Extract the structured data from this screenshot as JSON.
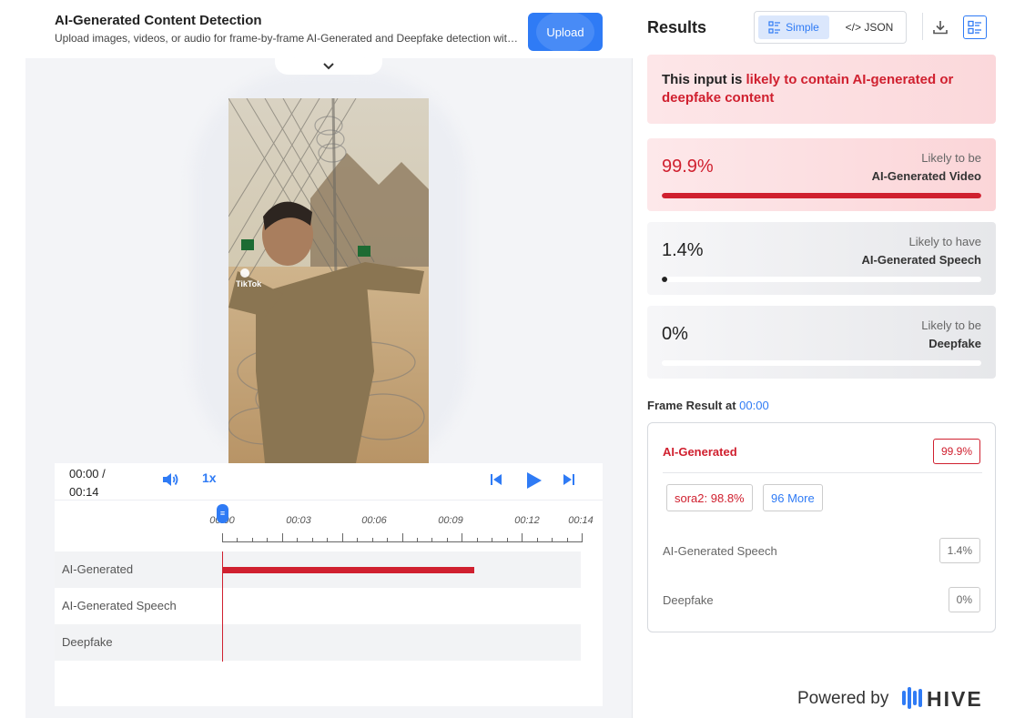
{
  "header": {
    "title": "AI-Generated Content Detection",
    "subtitle": "Upload images, videos, or audio for frame-by-frame AI-Generated and Deepfake detection with...",
    "upload_label": "Upload"
  },
  "video": {
    "watermark": "TikTok"
  },
  "player": {
    "current_time": "00:00 /",
    "duration": "00:14",
    "speed": "1x",
    "ticks": [
      "00:00",
      "00:03",
      "00:06",
      "00:09",
      "00:12",
      "00:14"
    ],
    "tracks": [
      {
        "label": "AI-Generated",
        "active_fraction": 0.7
      },
      {
        "label": "AI-Generated Speech",
        "active_fraction": 0
      },
      {
        "label": "Deepfake",
        "active_fraction": 0
      }
    ]
  },
  "results": {
    "title": "Results",
    "simple_label": "Simple",
    "json_label": "</> JSON",
    "verdict_prefix": "This input is ",
    "verdict_highlight": "likely to contain AI-generated or deepfake content",
    "cards": [
      {
        "pct": "99.9%",
        "value": 0.999,
        "line1": "Likely to be",
        "line2": "AI-Generated Video",
        "tone": "red"
      },
      {
        "pct": "1.4%",
        "value": 0.014,
        "line1": "Likely to have",
        "line2": "AI-Generated Speech",
        "tone": "gray"
      },
      {
        "pct": "0%",
        "value": 0,
        "line1": "Likely to be",
        "line2": "Deepfake",
        "tone": "gray"
      }
    ],
    "frame_result_label": "Frame Result at ",
    "frame_result_time": "00:00",
    "frame": {
      "ai_generated_label": "AI-Generated",
      "ai_generated_score": "99.9%",
      "chip_model": "sora2: 98.8%",
      "chip_more": "96 More",
      "speech_label": "AI-Generated Speech",
      "speech_score": "1.4%",
      "deepfake_label": "Deepfake",
      "deepfake_score": "0%"
    }
  },
  "footer": {
    "powered_by": "Powered by",
    "brand": "HIVE"
  },
  "colors": {
    "accent": "#2f7bf5",
    "alert": "#d0202f"
  },
  "icons": [
    "chevron-down-icon",
    "volume-icon",
    "skip-previous-icon",
    "play-icon",
    "skip-next-icon",
    "list-view-icon",
    "download-icon",
    "hive-logo-icon"
  ]
}
